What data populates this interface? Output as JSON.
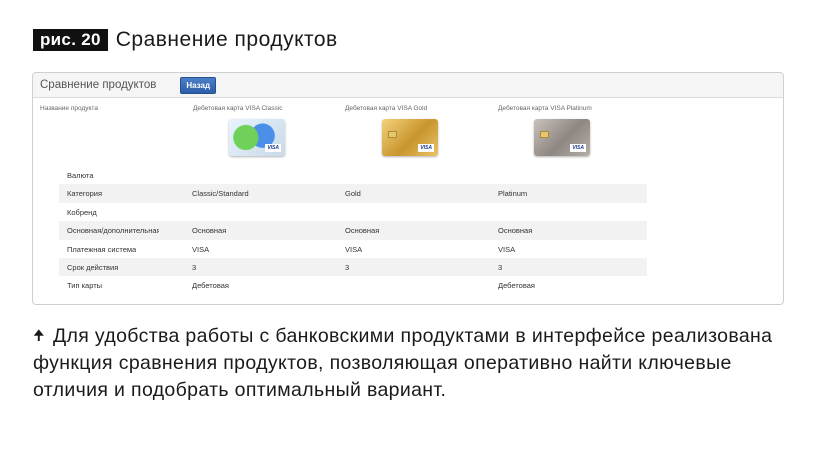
{
  "figure": {
    "badge": "рис. 20",
    "title": "Сравнение продуктов"
  },
  "panel": {
    "title": "Сравнение продуктов",
    "back_button": "Назад",
    "name_header": "Название продукта",
    "products": [
      {
        "name": "Дебетовая карта VISA Classic",
        "card_icon": "visa-classic-card-icon"
      },
      {
        "name": "Дебетовая карта VISA Gold",
        "card_icon": "visa-gold-card-icon"
      },
      {
        "name": "Дебетовая карта VISA Platinum",
        "card_icon": "visa-platinum-card-icon"
      }
    ],
    "card_brand": "VISA",
    "rows": [
      {
        "label": "Валюта",
        "values": [
          "",
          "",
          ""
        ]
      },
      {
        "label": "Категория",
        "values": [
          "Classic/Standard",
          "Gold",
          "Platinum"
        ]
      },
      {
        "label": "Кобренд",
        "values": [
          "",
          "",
          ""
        ]
      },
      {
        "label": "Основная/дополнительная",
        "values": [
          "Основная",
          "Основная",
          "Основная"
        ]
      },
      {
        "label": "Платежная система",
        "values": [
          "VISA",
          "VISA",
          "VISA"
        ]
      },
      {
        "label": "Срок действия",
        "values": [
          "3",
          "3",
          "3"
        ]
      },
      {
        "label": "Тип карты",
        "values": [
          "Дебетовая",
          "",
          "Дебетовая"
        ]
      }
    ]
  },
  "caption": {
    "icon": "arrow-up-icon",
    "arrow": "🠉",
    "text": "Для удобства работы с банковскими продуктами в интерфейсе реализована функция сравнения продуктов, позволяющая оперативно найти ключевые отличия и подобрать оптимальный вариант."
  }
}
